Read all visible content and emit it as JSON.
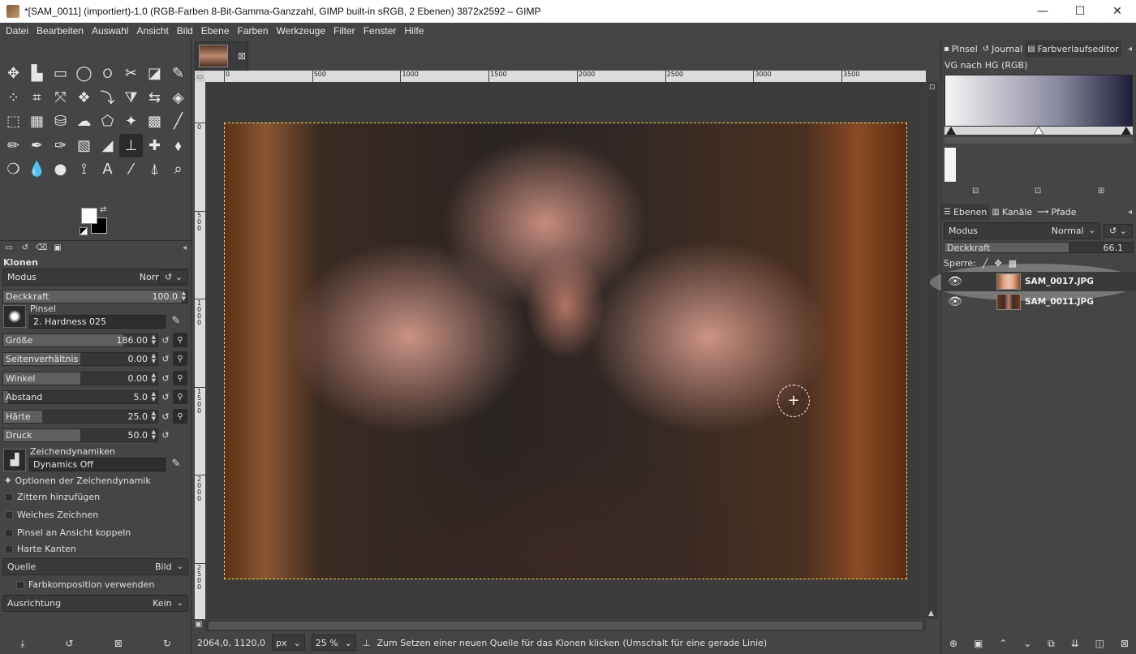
{
  "window": {
    "title": "*[SAM_0011] (importiert)-1.0 (RGB-Farben 8-Bit-Gamma-Ganzzahl, GIMP built-in sRGB, 2 Ebenen) 3872x2592 – GIMP",
    "minimize": "—",
    "maximize": "☐",
    "close": "✕"
  },
  "menu": [
    "Datei",
    "Bearbeiten",
    "Auswahl",
    "Ansicht",
    "Bild",
    "Ebene",
    "Farben",
    "Werkzeuge",
    "Filter",
    "Fenster",
    "Hilfe"
  ],
  "tools": [
    {
      "name": "move-tool",
      "glyph": "✥"
    },
    {
      "name": "align-tool",
      "glyph": "▙"
    },
    {
      "name": "rect-select-tool",
      "glyph": "▭"
    },
    {
      "name": "ellipse-select-tool",
      "glyph": "◯"
    },
    {
      "name": "free-select-tool",
      "glyph": "ଠ"
    },
    {
      "name": "scissors-tool",
      "glyph": "✂"
    },
    {
      "name": "foreground-select-tool",
      "glyph": "◪"
    },
    {
      "name": "fuzzy-select-tool",
      "glyph": "✎"
    },
    {
      "name": "color-select-tool",
      "glyph": "⁘"
    },
    {
      "name": "crop-tool",
      "glyph": "⌗"
    },
    {
      "name": "unified-transform-tool",
      "glyph": "⤧"
    },
    {
      "name": "warp-tool",
      "glyph": "❖"
    },
    {
      "name": "rotate-tool",
      "glyph": "⤵"
    },
    {
      "name": "shear-tool",
      "glyph": "⧩"
    },
    {
      "name": "flip-tool",
      "glyph": "⇆"
    },
    {
      "name": "perspective-tool",
      "glyph": "◈"
    },
    {
      "name": "3d-transform-tool",
      "glyph": "⬚"
    },
    {
      "name": "gegl-tool",
      "glyph": "▦"
    },
    {
      "name": "bucket-tool",
      "glyph": "⛁"
    },
    {
      "name": "smudge-tool",
      "glyph": "☁"
    },
    {
      "name": "cage-tool",
      "glyph": "⬠"
    },
    {
      "name": "paint-tool",
      "glyph": "✦"
    },
    {
      "name": "blend-tool",
      "glyph": "▩"
    },
    {
      "name": "paintbrush-tool",
      "glyph": "╱"
    },
    {
      "name": "pencil-tool",
      "glyph": "✏"
    },
    {
      "name": "airbrush-tool",
      "glyph": "✒"
    },
    {
      "name": "ink-tool",
      "glyph": "✑"
    },
    {
      "name": "mypaint-tool",
      "glyph": "▧"
    },
    {
      "name": "eraser-tool",
      "glyph": "◢"
    },
    {
      "name": "clone-tool",
      "glyph": "⊥"
    },
    {
      "name": "heal-tool",
      "glyph": "✚"
    },
    {
      "name": "perspective-clone-tool",
      "glyph": "⬧"
    },
    {
      "name": "blur-tool",
      "glyph": "❍"
    },
    {
      "name": "dodge-tool",
      "glyph": "💧"
    },
    {
      "name": "burn-tool",
      "glyph": "●"
    },
    {
      "name": "path-tool",
      "glyph": "⟟"
    },
    {
      "name": "text-tool",
      "glyph": "A"
    },
    {
      "name": "color-picker-tool",
      "glyph": "⁄"
    },
    {
      "name": "measure-tool",
      "glyph": "⍋"
    },
    {
      "name": "zoom-tool",
      "glyph": "⌕"
    }
  ],
  "active_tool_index": 29,
  "tool_options": {
    "title": "Klonen",
    "mode_label": "Modus",
    "mode_value": "Normal",
    "opacity_label": "Deckkraft",
    "opacity_value": "100.0",
    "opacity_fraction": 1.0,
    "brush_label": "Pinsel",
    "brush_name": "2. Hardness 025",
    "sliders": [
      {
        "label": "Größe",
        "value": "186.00",
        "fraction": 0.78
      },
      {
        "label": "Seitenverhältnis",
        "value": "0.00",
        "fraction": 0.5
      },
      {
        "label": "Winkel",
        "value": "0.00",
        "fraction": 0.5
      },
      {
        "label": "Abstand",
        "value": "5.0",
        "fraction": 0.03
      },
      {
        "label": "Härte",
        "value": "25.0",
        "fraction": 0.25
      },
      {
        "label": "Druck",
        "value": "50.0",
        "fraction": 0.5
      }
    ],
    "dynamics_label": "Zeichendynamiken",
    "dynamics_name": "Dynamics Off",
    "dynamics_options": "Optionen der Zeichendynamik",
    "checks": [
      "Zittern hinzufügen",
      "Weiches Zeichnen",
      "Pinsel an Ansicht koppeln",
      "Harte Kanten"
    ],
    "source_label": "Quelle",
    "source_value": "Bild",
    "sample_merged": "Farbkomposition verwenden",
    "alignment_label": "Ausrichtung",
    "alignment_value": "Kein"
  },
  "rulers": {
    "h_ticks": [
      {
        "label": "0",
        "pos": 0
      },
      {
        "label": "500",
        "pos": 500
      },
      {
        "label": "1000",
        "pos": 1000
      },
      {
        "label": "1500",
        "pos": 1500
      },
      {
        "label": "2000",
        "pos": 2000
      },
      {
        "label": "2500",
        "pos": 2500
      },
      {
        "label": "3000",
        "pos": 3000
      },
      {
        "label": "3500",
        "pos": 3500
      }
    ],
    "v_ticks": [
      {
        "label": "0",
        "pos": 0
      },
      {
        "label": "500",
        "pos": 500
      },
      {
        "label": "1000",
        "pos": 1000
      },
      {
        "label": "1500",
        "pos": 1500
      },
      {
        "label": "2000",
        "pos": 2000
      },
      {
        "label": "2500",
        "pos": 2500
      }
    ]
  },
  "status": {
    "coords": "2064,0, 1120,0",
    "unit": "px",
    "zoom": "25 %",
    "message": "Zum Setzen einer neuen Quelle für das Klonen klicken (Umschalt für eine gerade Linie)"
  },
  "dock_top": {
    "tabs": [
      {
        "name": "pinsel",
        "label": "Pinsel",
        "icon": "▪"
      },
      {
        "name": "journal",
        "label": "Journal",
        "icon": "↺"
      },
      {
        "name": "farbverlaufseditor",
        "label": "Farbverlaufseditor",
        "icon": "▤"
      }
    ],
    "gradient_name": "VG nach HG (RGB)"
  },
  "dock_layers": {
    "tabs": [
      {
        "name": "ebenen",
        "label": "Ebenen",
        "icon": "☰"
      },
      {
        "name": "kanaele",
        "label": "Kanäle",
        "icon": "▥"
      },
      {
        "name": "pfade",
        "label": "Pfade",
        "icon": "⟿"
      }
    ],
    "mode_label": "Modus",
    "mode_value": "Normal",
    "opacity_label": "Deckkraft",
    "opacity_value": "66.1",
    "opacity_fraction": 0.661,
    "lock_label": "Sperre:",
    "layers": [
      {
        "name": "SAM_0017.JPG",
        "active": true
      },
      {
        "name": "SAM_0011.JPG",
        "active": false
      }
    ]
  }
}
